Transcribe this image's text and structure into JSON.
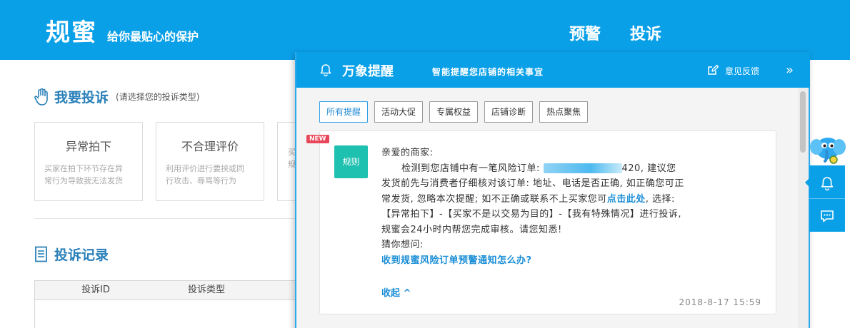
{
  "header": {
    "brand": "规蜜",
    "slogan": "给你最贴心的保护",
    "nav": {
      "warning": "预警",
      "complaint": "投诉"
    }
  },
  "complain_section": {
    "title": "我要投诉",
    "subtitle": "(请选择您的投诉类型)",
    "cards": [
      {
        "title": "异常拍下",
        "desc_line1": "买家在拍下环节存在异",
        "desc_line2": "常行为导致我无法发货"
      },
      {
        "title": "不合理评价",
        "desc_line1": "利用评价进行要挟或同",
        "desc_line2": "行攻击、辱骂等行为"
      },
      {
        "title": "",
        "desc_line1": "买",
        "desc_line2": "规"
      }
    ]
  },
  "records_section": {
    "title": "投诉记录",
    "columns": [
      "投诉ID",
      "投诉类型"
    ]
  },
  "panel": {
    "title": "万象提醒",
    "subtitle": "智能提醒您店铺的相关事宜",
    "feedback_label": "意见反馈",
    "collapse_glyph": "»",
    "filters": [
      "所有提醒",
      "活动大促",
      "专属权益",
      "店铺诊断",
      "热点聚焦"
    ],
    "message": {
      "new_badge": "NEW",
      "rule_badge": "规则",
      "greeting": "亲爱的商家:",
      "p1_start": "检测到您店铺中有一笔风险订单: ",
      "p1_order_suffix": "420, 建议您",
      "p2": "发货前先与消费者仔细核对该订单: 地址、电话是否正确, 如正确您可正",
      "p3_start": "常发货, 忽略本次提醒; 如不正确或联系不上买家您可",
      "p3_link": "点击此处",
      "p3_end": ", 选择:",
      "p4": "【异常拍下】-【买家不是以交易为目的】-【我有特殊情况】进行投诉,",
      "p5": "规蜜会24小时内帮您完成审核。请您知悉!",
      "guess_label": "猜你想问:",
      "faq": "收到规蜜风险订单预警通知怎么办?",
      "fold_label": "收起 ^",
      "timestamp": "2018-8-17 15:59"
    }
  },
  "icons": {
    "bell": "bell-icon",
    "edit": "edit-icon",
    "chat": "chat-icon",
    "hand": "hand-icon",
    "document": "document-icon",
    "mascot": "elephant-mascot-icon"
  },
  "colors": {
    "primary_blue": "#0aa0e8",
    "link_blue": "#1b8ed6",
    "rule_teal": "#1ec0b0",
    "new_red": "#e8475a"
  }
}
